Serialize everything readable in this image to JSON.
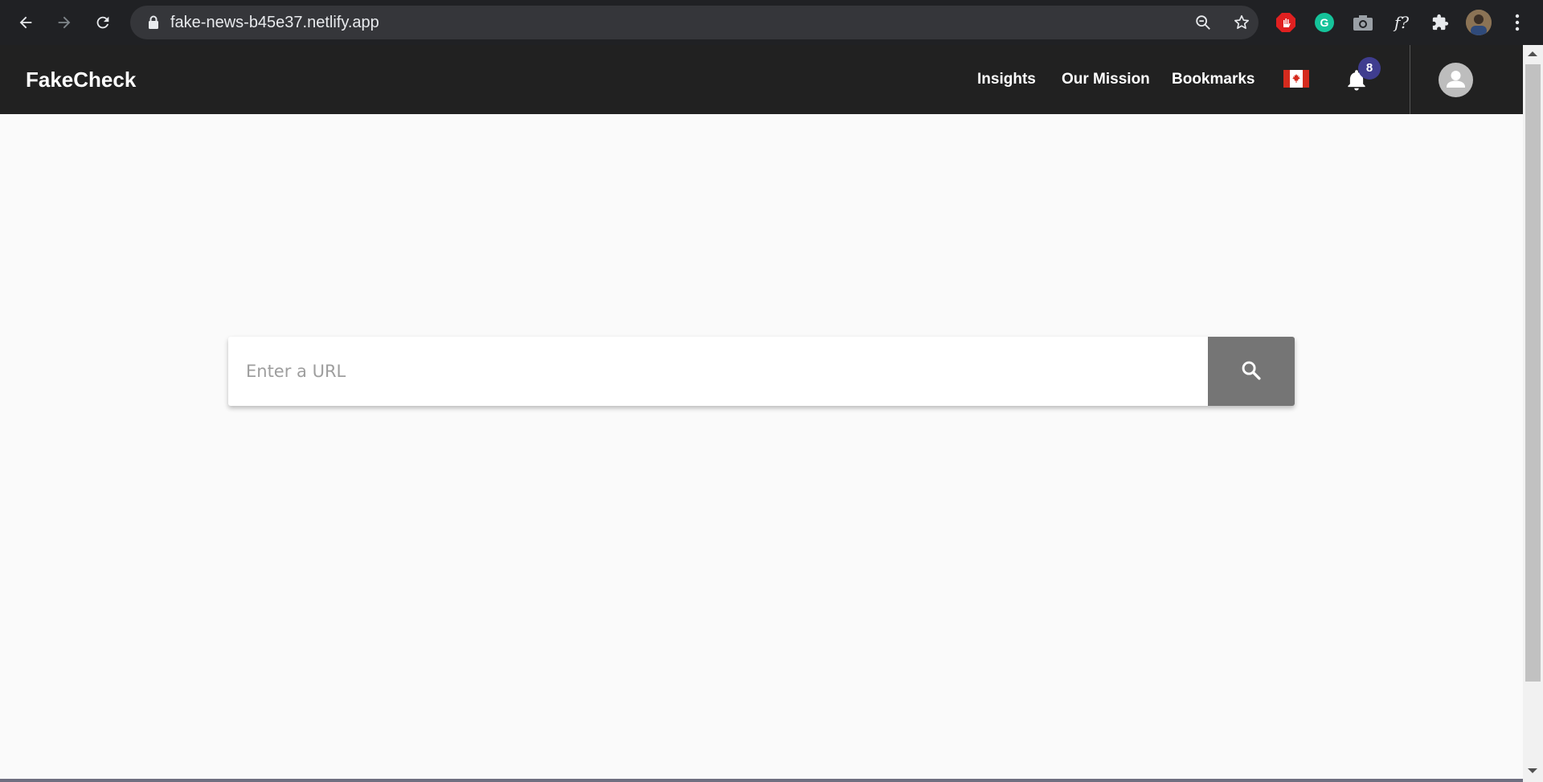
{
  "browser": {
    "url": "fake-news-b45e37.netlify.app",
    "icons": [
      "back-icon",
      "forward-icon",
      "reload-icon",
      "lock-icon",
      "zoom-out-icon",
      "star-icon",
      "stop-hand-extension-icon",
      "grammarly-extension-icon",
      "camera-extension-icon",
      "font-extension-icon",
      "extensions-puzzle-icon",
      "profile-avatar-icon",
      "menu-dots-icon"
    ],
    "font_ext_label": "f?"
  },
  "header": {
    "brand": "FakeCheck",
    "nav": {
      "insights": "Insights",
      "mission": "Our Mission",
      "bookmarks": "Bookmarks"
    },
    "notification_count": "8",
    "colors": {
      "header_bg": "#212121",
      "badge": "#3f3d8f",
      "flag_red": "#d52b1e"
    }
  },
  "search": {
    "placeholder": "Enter a URL",
    "value": "",
    "button_color": "#757575"
  }
}
